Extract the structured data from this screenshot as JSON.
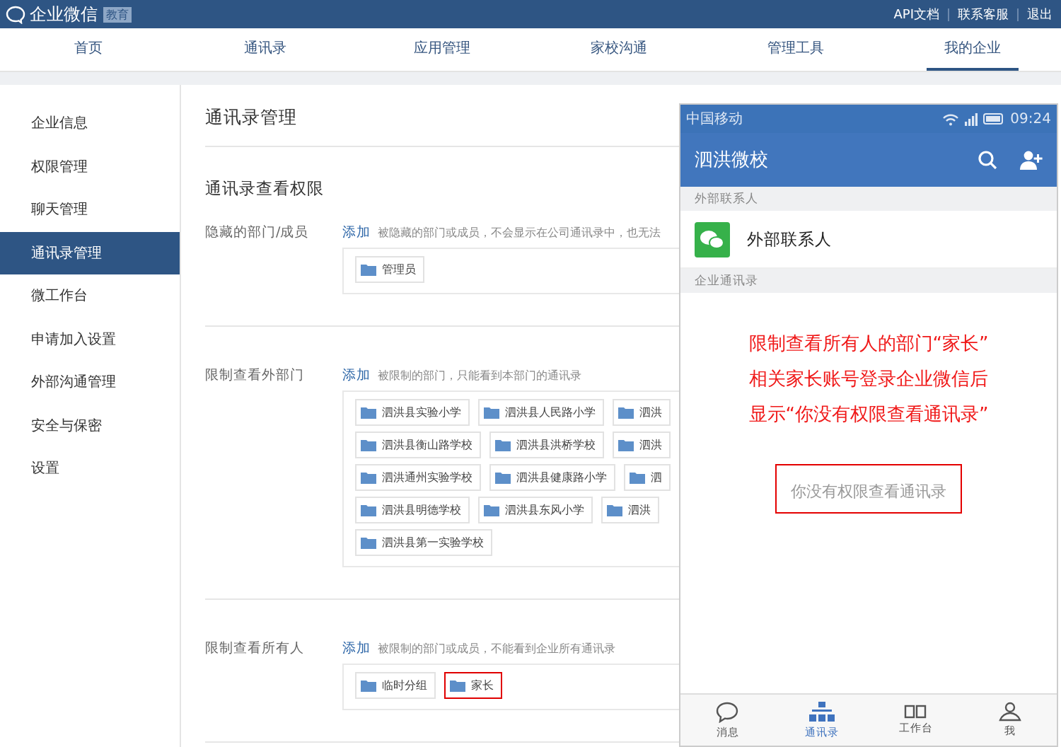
{
  "header": {
    "logo_text": "企业微信",
    "badge": "教育",
    "links": [
      "API文档",
      "联系客服",
      "退出"
    ]
  },
  "nav": [
    {
      "label": "首页",
      "selected": false
    },
    {
      "label": "通讯录",
      "selected": false
    },
    {
      "label": "应用管理",
      "selected": false
    },
    {
      "label": "家校沟通",
      "selected": false
    },
    {
      "label": "管理工具",
      "selected": false
    },
    {
      "label": "我的企业",
      "selected": true
    }
  ],
  "sidebar": [
    {
      "label": "企业信息",
      "selected": false
    },
    {
      "label": "权限管理",
      "selected": false
    },
    {
      "label": "聊天管理",
      "selected": false
    },
    {
      "label": "通讯录管理",
      "selected": true
    },
    {
      "label": "微工作台",
      "selected": false
    },
    {
      "label": "申请加入设置",
      "selected": false
    },
    {
      "label": "外部沟通管理",
      "selected": false
    },
    {
      "label": "安全与保密",
      "selected": false
    },
    {
      "label": "设置",
      "selected": false
    }
  ],
  "main": {
    "title": "通讯录管理",
    "section_title": "通讯录查看权限",
    "rows": [
      {
        "label": "隐藏的部门/成员",
        "add_link": "添加",
        "hint": "被隐藏的部门或成员，不会显示在公司通讯录中，也无法",
        "chip_rows": [
          [
            {
              "label": "管理员",
              "highlighted": false
            }
          ]
        ]
      },
      {
        "label": "限制查看外部门",
        "add_link": "添加",
        "hint": "被限制的部门，只能看到本部门的通讯录",
        "chip_rows": [
          [
            {
              "label": "泗洪县实验小学",
              "highlighted": false
            },
            {
              "label": "泗洪县人民路小学",
              "highlighted": false
            },
            {
              "label": "泗洪",
              "highlighted": false
            }
          ],
          [
            {
              "label": "泗洪县衡山路学校",
              "highlighted": false
            },
            {
              "label": "泗洪县洪桥学校",
              "highlighted": false
            },
            {
              "label": "泗洪",
              "highlighted": false
            }
          ],
          [
            {
              "label": "泗洪通州实验学校",
              "highlighted": false
            },
            {
              "label": "泗洪县健康路小学",
              "highlighted": false
            },
            {
              "label": "泗",
              "highlighted": false
            }
          ],
          [
            {
              "label": "泗洪县明德学校",
              "highlighted": false
            },
            {
              "label": "泗洪县东风小学",
              "highlighted": false
            },
            {
              "label": "泗洪",
              "highlighted": false
            }
          ],
          [
            {
              "label": "泗洪县第一实验学校",
              "highlighted": false
            }
          ]
        ]
      },
      {
        "label": "限制查看所有人",
        "add_link": "添加",
        "hint": "被限制的部门或成员，不能看到企业所有通讯录",
        "chip_rows": [
          [
            {
              "label": "临时分组",
              "highlighted": false
            },
            {
              "label": "家长",
              "highlighted": true
            }
          ]
        ]
      }
    ]
  },
  "phone": {
    "carrier": "中国移动",
    "time": "09:24",
    "title": "泗洪微校",
    "section_external": "外部联系人",
    "external_item": "外部联系人",
    "section_company": "企业通讯录",
    "annotation": [
      "限制查看所有人的部门“家长”",
      "相关家长账号登录企业微信后",
      "显示“你没有权限查看通讯录”"
    ],
    "notice": "你没有权限查看通讯录",
    "tabs": [
      {
        "label": "消息",
        "kind": "chat",
        "selected": false
      },
      {
        "label": "通讯录",
        "kind": "contacts",
        "selected": true
      },
      {
        "label": "工作台",
        "kind": "workbench",
        "selected": false
      },
      {
        "label": "我",
        "kind": "me",
        "selected": false
      }
    ]
  }
}
